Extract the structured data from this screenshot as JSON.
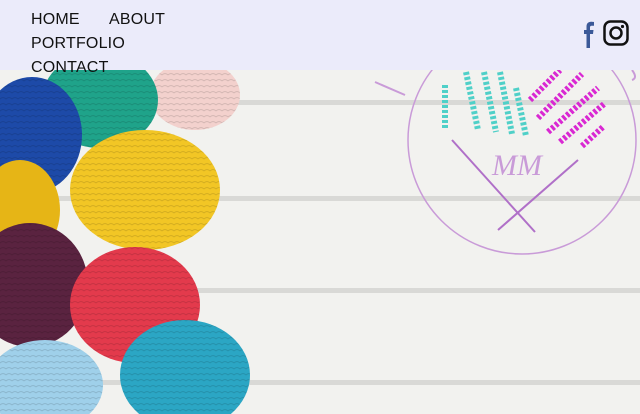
{
  "nav": {
    "items": [
      {
        "label": "HOME"
      },
      {
        "label": "ABOUT"
      },
      {
        "label": "PORTFOLIO"
      },
      {
        "label": "CONTACT"
      }
    ]
  },
  "social": {
    "facebook_icon": "facebook-icon",
    "instagram_icon": "instagram-icon",
    "facebook_color": "#3b5998",
    "instagram_color": "#111111"
  },
  "logo": {
    "monogram": "MM",
    "ring_color": "#c99bd8",
    "teal_color": "#4fd0c8",
    "magenta_color": "#d928d2"
  },
  "colors": {
    "nav_bg": "#ebebfa",
    "boards": "#f3f3f1"
  }
}
